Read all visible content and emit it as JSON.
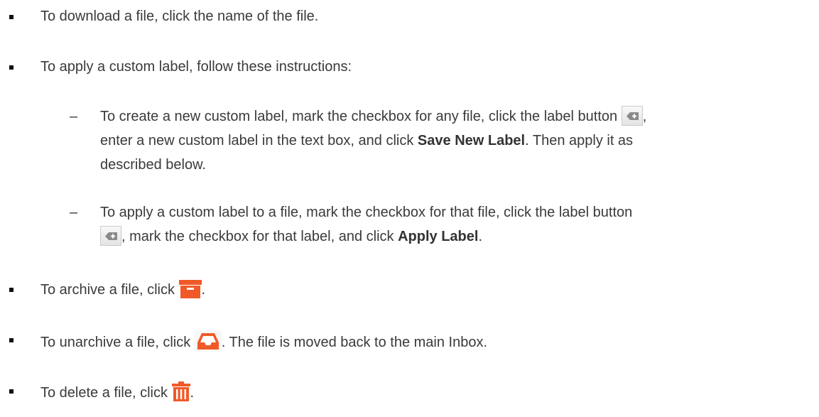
{
  "bullets": {
    "download": "To download a file, click the name of the file.",
    "custom_label_intro": "To apply a custom label, follow these instructions:",
    "create_label": {
      "dash": "–",
      "line1_pre": "To create a new custom label, mark the checkbox for any file, click the label button",
      "line1_post": ",",
      "line2_pre": "enter a new custom label in the text box, and click",
      "line2_bold": "Save New Label",
      "line2_post": ". Then apply it as",
      "line3": "described below."
    },
    "apply_label": {
      "dash": "–",
      "line1": "To apply a custom label to a file, mark the checkbox for that file, click the label button",
      "line2_post": ", mark the checkbox for that label, and click",
      "line2_bold": "Apply Label",
      "line2_end": "."
    },
    "archive": {
      "pre": "To archive a file, click",
      "post": "."
    },
    "unarchive": {
      "pre": "To unarchive a file, click",
      "post": ". The file is moved back to the main Inbox."
    },
    "delete": {
      "pre": "To delete a file, click",
      "post": "."
    }
  },
  "icons": {
    "label_button": "label-tag-icon",
    "archive": "archive-box-icon",
    "unarchive": "inbox-tray-icon",
    "delete": "trash-can-icon"
  },
  "colors": {
    "text": "#3a3a3a",
    "icon_orange": "#f05a28",
    "label_button_border": "#c9c9c9",
    "label_icon_gray": "#8a8a8a"
  }
}
